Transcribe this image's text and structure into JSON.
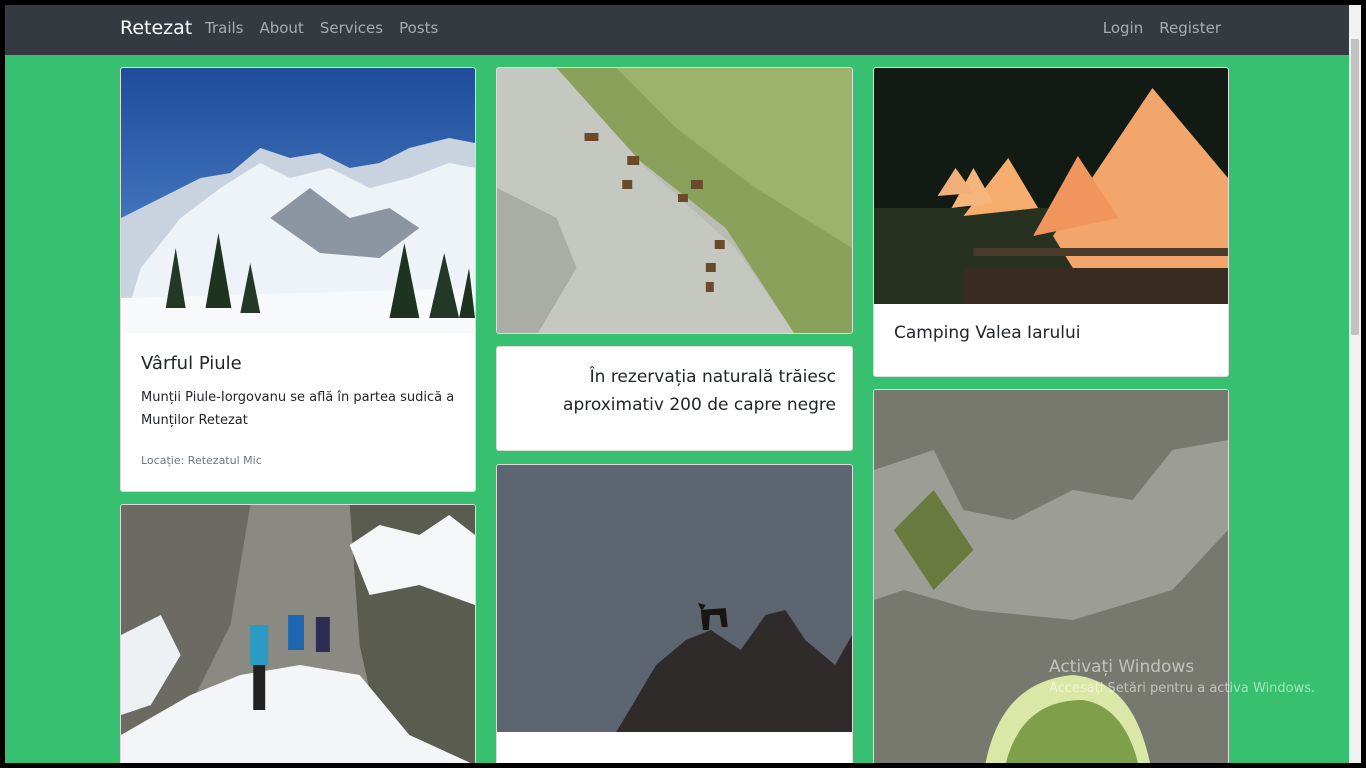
{
  "navbar": {
    "brand": "Retezat",
    "links": [
      "Trails",
      "About",
      "Services",
      "Posts"
    ],
    "right_links": [
      "Login",
      "Register"
    ]
  },
  "cards": {
    "piule": {
      "image": "snowy-mountain-photo",
      "title": "Vârful Piule",
      "text": "Munții Piule-Iorgovanu se află în partea sudică a Munților Retezat",
      "location": "Locație: Retezatul Mic"
    },
    "chamois_cliff": {
      "image": "chamois-on-cliff-photo"
    },
    "quote": {
      "text": "În rezervația naturală trăiesc aproximativ 200 de capre negre"
    },
    "chamois_silhouette": {
      "image": "chamois-silhouette-photo"
    },
    "camping": {
      "image": "glamping-tents-photo",
      "title": "Camping Valea Iarului"
    },
    "snow_gorge": {
      "image": "hikers-snow-gorge-photo"
    },
    "rock_arch": {
      "image": "rock-arch-photo"
    }
  },
  "watermark": {
    "line1": "Activați Windows",
    "line2": "Accesați Setări pentru a activa Windows."
  },
  "colors": {
    "page_bg": "#37c06f",
    "navbar_bg": "#343a40"
  }
}
